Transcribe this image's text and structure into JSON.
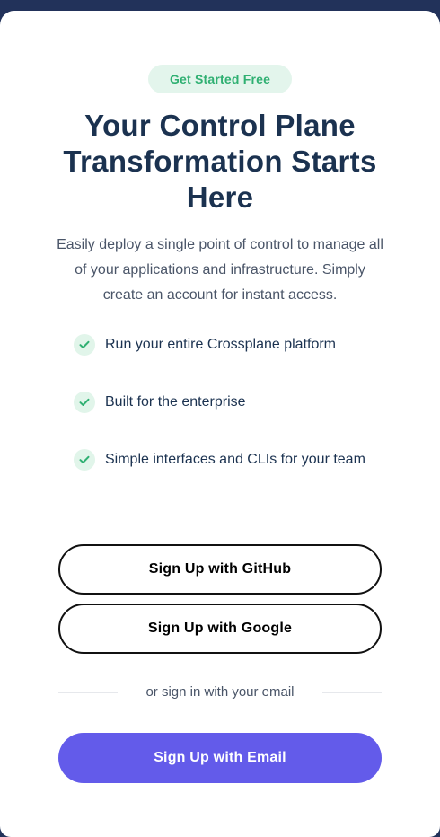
{
  "badge": "Get Started Free",
  "title": "Your Control Plane Transformation Starts Here",
  "subtitle": "Easily deploy a single point of control to manage all of your applications and infrastructure. Simply create an account for instant access.",
  "features": [
    {
      "icon": "check-icon",
      "label": "Run your entire Crossplane platform"
    },
    {
      "icon": "check-icon",
      "label": "Built for the enterprise"
    },
    {
      "icon": "check-icon",
      "label": "Simple interfaces and CLIs for your team"
    }
  ],
  "buttons": {
    "github": "Sign Up with GitHub",
    "google": "Sign Up with Google",
    "email": "Sign Up with Email"
  },
  "or_text": "or sign in with your email",
  "colors": {
    "header_band": "#22325a",
    "badge_bg": "#e3f5ec",
    "badge_text": "#2fb072",
    "title": "#1b3250",
    "check": "#2fb072",
    "email_button": "#635bea"
  }
}
